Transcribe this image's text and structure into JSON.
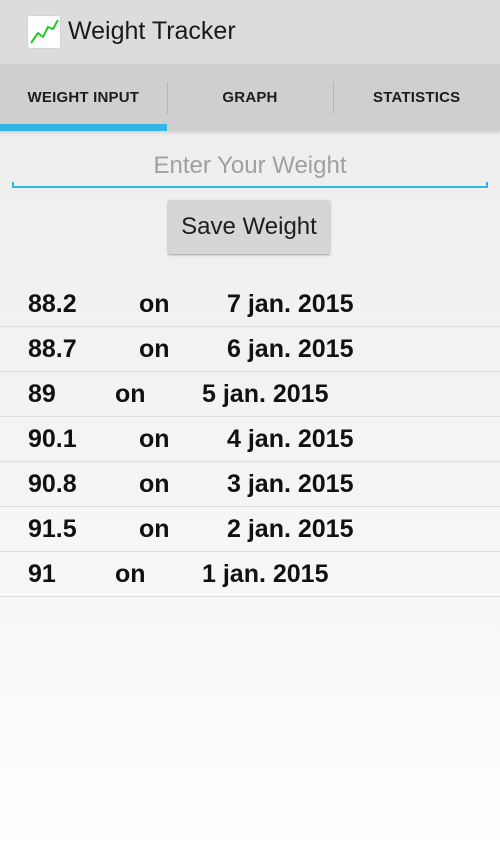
{
  "app": {
    "title": "Weight Tracker",
    "icon": "line-graph-icon"
  },
  "tabs": [
    {
      "label": "WEIGHT INPUT",
      "active": true
    },
    {
      "label": "GRAPH",
      "active": false
    },
    {
      "label": "STATISTICS",
      "active": false
    }
  ],
  "input": {
    "placeholder": "Enter Your Weight",
    "value": ""
  },
  "save_button": {
    "label": "Save Weight"
  },
  "entries": [
    {
      "weight": "88.2",
      "joiner": "on",
      "date": "7 jan. 2015"
    },
    {
      "weight": "88.7",
      "joiner": "on",
      "date": "6 jan. 2015"
    },
    {
      "weight": "89",
      "joiner": "on",
      "date": "5 jan. 2015"
    },
    {
      "weight": "90.1",
      "joiner": "on",
      "date": "4 jan. 2015"
    },
    {
      "weight": "90.8",
      "joiner": "on",
      "date": "3 jan. 2015"
    },
    {
      "weight": "91.5",
      "joiner": "on",
      "date": "2 jan. 2015"
    },
    {
      "weight": "91",
      "joiner": "on",
      "date": "1 jan. 2015"
    }
  ],
  "colors": {
    "accent": "#33b5e5",
    "icon_line": "#22cc22",
    "action_bar": "#dcdcdc",
    "tab_bar": "#cfcfcf"
  }
}
